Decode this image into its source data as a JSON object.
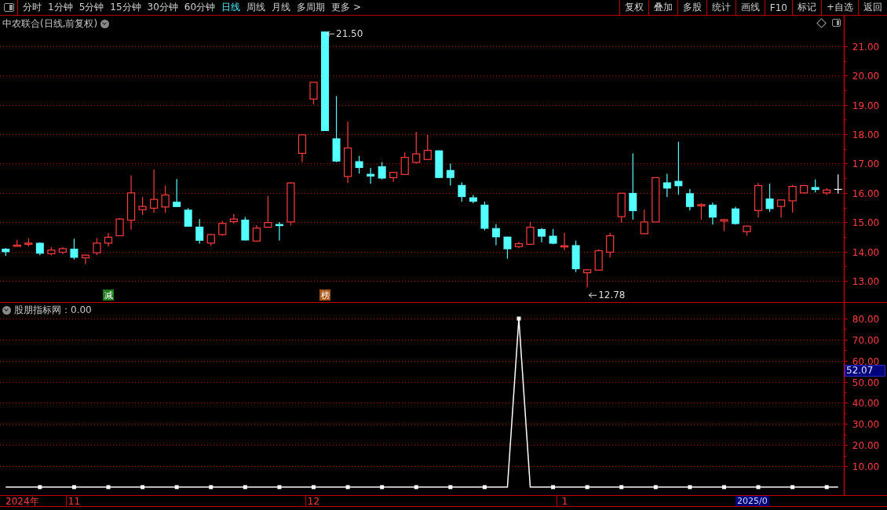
{
  "toolbar": {
    "tabs": [
      {
        "label": "分时",
        "selected": false
      },
      {
        "label": "1分钟",
        "selected": false
      },
      {
        "label": "5分钟",
        "selected": false
      },
      {
        "label": "15分钟",
        "selected": false
      },
      {
        "label": "30分钟",
        "selected": false
      },
      {
        "label": "60分钟",
        "selected": false
      },
      {
        "label": "日线",
        "selected": true
      },
      {
        "label": "周线",
        "selected": false
      },
      {
        "label": "月线",
        "selected": false
      },
      {
        "label": "多周期",
        "selected": false
      },
      {
        "label": "更多 >",
        "selected": false
      }
    ],
    "buttons": [
      "复权",
      "叠加",
      "多股",
      "统计",
      "画线",
      "F10",
      "标记",
      "+自选",
      "返回"
    ]
  },
  "main_panel": {
    "title": "中农联合(日线,前复权)",
    "chart_data": {
      "type": "candlestick",
      "grid": true,
      "ylim": [
        12.28,
        22.04
      ],
      "categories": [
        null,
        null,
        null,
        null,
        null,
        null,
        null,
        null,
        null,
        "减",
        null,
        null,
        null,
        null,
        null,
        null,
        null,
        null,
        null,
        null,
        null,
        null,
        null,
        null,
        null,
        null,
        null,
        null,
        "榜",
        null,
        null,
        null,
        null,
        null,
        null,
        null,
        null,
        null,
        null,
        null,
        null,
        null,
        null,
        null,
        null,
        null,
        null,
        null,
        null,
        null,
        null,
        null,
        null,
        null,
        null,
        null,
        null,
        null,
        null,
        null,
        null,
        null,
        null,
        null,
        null,
        null,
        null,
        null,
        null,
        null,
        null,
        null,
        null,
        null
      ],
      "yticks": [
        {
          "value": 13,
          "label": "13.00"
        },
        {
          "value": 14,
          "label": "14.00"
        },
        {
          "value": 15,
          "label": "15.00"
        },
        {
          "value": 16,
          "label": "16.00"
        },
        {
          "value": 17,
          "label": "17.00"
        },
        {
          "value": 18,
          "label": "18.00"
        },
        {
          "value": 19,
          "label": "19.00"
        },
        {
          "value": 20,
          "label": "20.00"
        },
        {
          "value": 21,
          "label": "21.00"
        }
      ],
      "ohlc": [
        [
          14.1,
          14.12,
          13.85,
          13.98
        ],
        [
          14.2,
          14.4,
          14.2,
          14.22
        ],
        [
          14.27,
          14.46,
          14.17,
          14.29
        ],
        [
          14.3,
          14.32,
          13.88,
          13.93
        ],
        [
          13.93,
          14.15,
          13.88,
          14.05
        ],
        [
          13.98,
          14.15,
          13.92,
          14.1
        ],
        [
          14.1,
          14.44,
          13.73,
          13.79
        ],
        [
          13.79,
          13.9,
          13.57,
          13.88
        ],
        [
          13.96,
          14.46,
          13.88,
          14.29
        ],
        [
          14.29,
          14.64,
          14.17,
          14.49
        ],
        [
          14.54,
          15.14,
          14.54,
          15.11
        ],
        [
          15.07,
          16.6,
          14.75,
          16.0
        ],
        [
          15.43,
          15.86,
          15.25,
          15.54
        ],
        [
          15.48,
          16.8,
          15.32,
          15.78
        ],
        [
          15.52,
          16.25,
          15.32,
          15.93
        ],
        [
          15.7,
          16.47,
          15.52,
          15.52
        ],
        [
          15.43,
          15.48,
          14.85,
          14.85
        ],
        [
          14.85,
          15.11,
          14.27,
          14.37
        ],
        [
          14.29,
          14.6,
          14.2,
          14.58
        ],
        [
          14.58,
          15.05,
          14.54,
          14.96
        ],
        [
          15.02,
          15.28,
          14.96,
          15.11
        ],
        [
          15.09,
          15.18,
          14.38,
          14.38
        ],
        [
          14.36,
          14.9,
          14.34,
          14.8
        ],
        [
          14.83,
          15.89,
          14.83,
          14.99
        ],
        [
          14.94,
          15.01,
          14.38,
          14.87
        ],
        [
          15.01,
          16.36,
          14.89,
          16.34
        ],
        [
          17.35,
          17.98,
          17.05,
          17.98
        ],
        [
          19.2,
          19.77,
          19.01,
          19.77
        ],
        [
          21.5,
          21.5,
          18.11,
          18.11
        ],
        [
          17.86,
          19.3,
          17.05,
          17.07
        ],
        [
          16.56,
          18.43,
          16.34,
          17.53
        ],
        [
          17.08,
          17.26,
          16.66,
          16.85
        ],
        [
          16.65,
          16.85,
          16.31,
          16.56
        ],
        [
          16.91,
          17.05,
          16.46,
          16.49
        ],
        [
          16.52,
          16.7,
          16.38,
          16.7
        ],
        [
          16.63,
          17.38,
          16.63,
          17.21
        ],
        [
          17.04,
          18.08,
          17.0,
          17.33
        ],
        [
          17.14,
          17.98,
          17.14,
          17.45
        ],
        [
          17.45,
          17.45,
          16.51,
          16.51
        ],
        [
          16.78,
          17.0,
          16.25,
          16.51
        ],
        [
          16.27,
          16.36,
          15.7,
          15.86
        ],
        [
          15.85,
          15.93,
          15.65,
          15.7
        ],
        [
          15.6,
          15.7,
          14.73,
          14.78
        ],
        [
          14.8,
          14.94,
          14.22,
          14.49
        ],
        [
          14.51,
          14.51,
          13.76,
          14.08
        ],
        [
          14.17,
          14.33,
          14.12,
          14.27
        ],
        [
          14.25,
          15.01,
          14.25,
          14.83
        ],
        [
          14.77,
          14.8,
          14.32,
          14.51
        ],
        [
          14.54,
          14.77,
          14.25,
          14.27
        ],
        [
          14.18,
          14.64,
          14.06,
          14.2
        ],
        [
          14.22,
          14.37,
          13.3,
          13.4
        ],
        [
          13.28,
          13.41,
          12.78,
          13.38
        ],
        [
          13.37,
          14.08,
          13.37,
          14.03
        ],
        [
          13.98,
          14.64,
          13.8,
          14.54
        ],
        [
          15.19,
          15.99,
          14.99,
          15.99
        ],
        [
          16.0,
          17.35,
          15.09,
          15.38
        ],
        [
          14.61,
          15.43,
          14.59,
          15.01
        ],
        [
          15.01,
          16.52,
          15.01,
          16.52
        ],
        [
          16.36,
          16.65,
          15.86,
          16.15
        ],
        [
          16.41,
          17.74,
          15.94,
          16.23
        ],
        [
          15.99,
          16.13,
          15.41,
          15.52
        ],
        [
          15.58,
          15.65,
          15.09,
          15.6
        ],
        [
          15.6,
          15.67,
          14.92,
          15.16
        ],
        [
          15.04,
          15.12,
          14.7,
          15.09
        ],
        [
          15.47,
          15.53,
          14.92,
          14.94
        ],
        [
          14.68,
          14.87,
          14.54,
          14.87
        ],
        [
          15.4,
          16.34,
          15.16,
          16.25
        ],
        [
          15.81,
          16.31,
          15.35,
          15.45
        ],
        [
          15.54,
          15.76,
          15.16,
          15.76
        ],
        [
          15.73,
          16.27,
          15.33,
          16.22
        ],
        [
          16.0,
          16.27,
          15.98,
          16.25
        ],
        [
          16.2,
          16.46,
          16.02,
          16.1
        ],
        [
          16.0,
          16.16,
          15.93,
          16.1
        ],
        [
          16.12,
          16.63,
          15.98,
          16.12
        ]
      ],
      "annotations": [
        "21.50",
        "12.78"
      ]
    },
    "signals": [
      {
        "color": "#1e7d1e"
      },
      {
        "color": "#a8561a"
      }
    ]
  },
  "indicator_panel": {
    "title": "股朋指标网：0.00",
    "chart_data": {
      "type": "line",
      "grid": true,
      "ylim": [
        -3.78,
        87.45
      ],
      "categories": [
        null,
        null,
        null,
        null,
        null,
        null,
        "11",
        null,
        null,
        null,
        null,
        null,
        null,
        null,
        null,
        null,
        null,
        null,
        null,
        null,
        null,
        null,
        null,
        null,
        null,
        null,
        null,
        "12",
        null,
        null,
        null,
        null,
        null,
        null,
        null,
        null,
        null,
        null,
        null,
        null,
        null,
        null,
        null,
        null,
        null,
        null,
        null,
        null,
        null,
        "1",
        null,
        null,
        null,
        null,
        null,
        null,
        null,
        null,
        null,
        null,
        null,
        null,
        null,
        null,
        null,
        null,
        null,
        null,
        null,
        null,
        null,
        null,
        null,
        null
      ],
      "yticks": [
        {
          "value": 10,
          "label": "10.00"
        },
        {
          "value": 20,
          "label": "20.00"
        },
        {
          "value": 30,
          "label": "30.00"
        },
        {
          "value": 40,
          "label": "40.00"
        },
        {
          "value": 50,
          "label": "50.00"
        },
        {
          "value": 60,
          "label": "60.00"
        },
        {
          "value": 70,
          "label": "70.00"
        },
        {
          "value": 80,
          "label": "80.00"
        }
      ],
      "series": [
        {
          "color": "#ffffff",
          "values": [
            0,
            0,
            0,
            0,
            0,
            0,
            0,
            0,
            0,
            0,
            0,
            0,
            0,
            0,
            0,
            0,
            0,
            0,
            0,
            0,
            0,
            0,
            0,
            0,
            0,
            0,
            0,
            0,
            0,
            0,
            0,
            0,
            0,
            0,
            0,
            0,
            0,
            0,
            0,
            0,
            0,
            0,
            0,
            0,
            0,
            80,
            0,
            0,
            0,
            0,
            0,
            0,
            0,
            0,
            0,
            0,
            0,
            0,
            0,
            0,
            0,
            0,
            0,
            0,
            0,
            0,
            0,
            0,
            0,
            0,
            0,
            0,
            0,
            0
          ]
        }
      ]
    },
    "cursor_value": "52.07"
  },
  "time_axis": {
    "start": "2024年",
    "end": "2025/0"
  }
}
